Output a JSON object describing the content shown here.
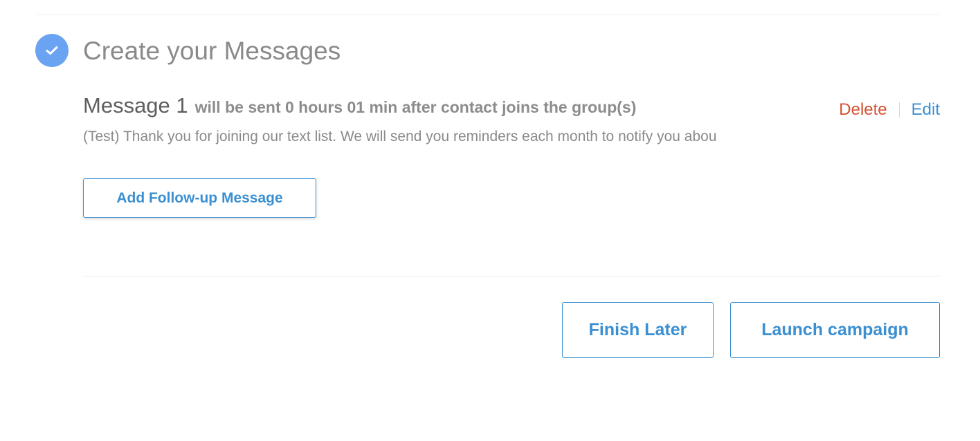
{
  "section": {
    "title": "Create your Messages",
    "step_icon": "check-icon",
    "step_color": "#6aa3f2"
  },
  "message": {
    "name": "Message 1",
    "schedule_text": "will be sent 0 hours 01 min after contact joins the group(s)",
    "preview": "(Test) Thank you for joining our text list. We will send you reminders each month to notify you abou",
    "delete_label": "Delete",
    "edit_label": "Edit"
  },
  "actions": {
    "add_followup_label": "Add Follow-up Message",
    "finish_later_label": "Finish Later",
    "launch_label": "Launch campaign"
  },
  "colors": {
    "accent": "#3a8fd1",
    "danger": "#d5512f",
    "muted_text": "#8a8a8a"
  }
}
